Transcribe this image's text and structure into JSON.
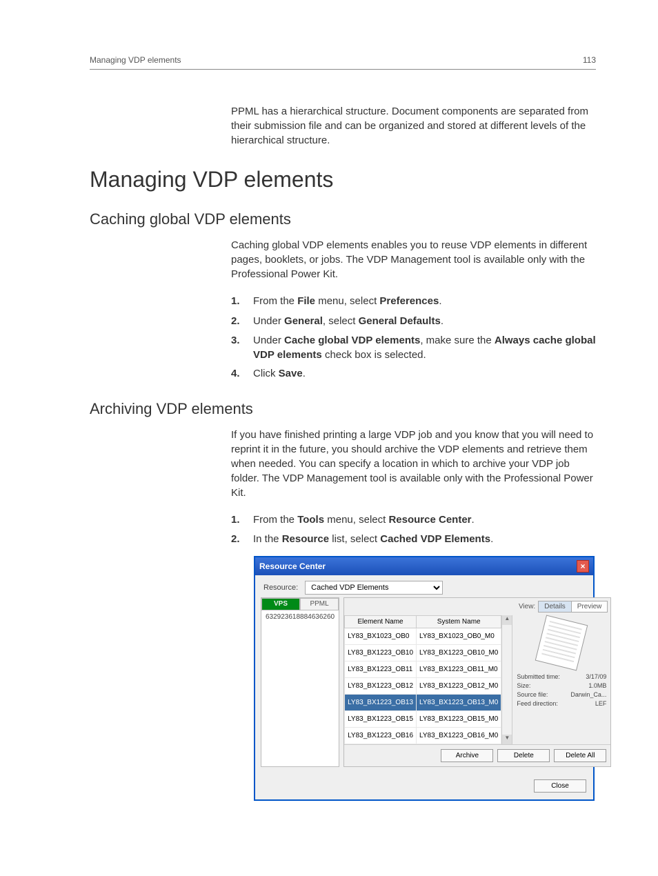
{
  "header": {
    "title": "Managing VDP elements",
    "page_num": "113"
  },
  "intro": "PPML has a hierarchical structure. Document components are separated from their submission file and can be organized and stored at different levels of the hierarchical structure.",
  "h1": "Managing VDP elements",
  "section1": {
    "heading": "Caching global VDP elements",
    "para": "Caching global VDP elements enables you to reuse VDP elements in different pages, booklets, or jobs. The VDP Management tool is available only with the Professional Power Kit.",
    "steps": {
      "s1": {
        "num": "1.",
        "prefix": "From the ",
        "b1": "File",
        "mid": " menu, select ",
        "b2": "Preferences",
        "suffix": "."
      },
      "s2": {
        "num": "2.",
        "prefix": "Under ",
        "b1": "General",
        "mid": ", select ",
        "b2": "General Defaults",
        "suffix": "."
      },
      "s3": {
        "num": "3.",
        "prefix": "Under ",
        "b1": "Cache global VDP elements",
        "mid": ", make sure the ",
        "b2": "Always cache global VDP elements",
        "suffix": " check box is selected."
      },
      "s4": {
        "num": "4.",
        "prefix": "Click ",
        "b1": "Save",
        "suffix": "."
      }
    }
  },
  "section2": {
    "heading": "Archiving VDP elements",
    "para": "If you have finished printing a large VDP job and you know that you will need to reprint it in the future, you should archive the VDP elements and retrieve them when needed. You can specify a location in which to archive your VDP job folder. The VDP Management tool is available only with the Professional Power Kit.",
    "steps": {
      "s1": {
        "num": "1.",
        "prefix": "From the ",
        "b1": "Tools",
        "mid": " menu, select ",
        "b2": "Resource Center",
        "suffix": "."
      },
      "s2": {
        "num": "2.",
        "prefix": "In the ",
        "b1": "Resource",
        "mid": " list, select ",
        "b2": "Cached VDP Elements",
        "suffix": "."
      }
    }
  },
  "dialog": {
    "title": "Resource Center",
    "resource_label": "Resource:",
    "resource_value": "Cached VDP Elements",
    "tabs": {
      "vps": "VPS",
      "ppml": "PPML"
    },
    "tree_item": "632923618884636260",
    "view_label": "View:",
    "view_toggle": {
      "details": "Details",
      "preview": "Preview"
    },
    "table": {
      "headers": {
        "element": "Element Name",
        "system": "System Name"
      },
      "rows": [
        {
          "element": "LY83_BX1023_OB0",
          "system": "LY83_BX1023_OB0_M0"
        },
        {
          "element": "LY83_BX1223_OB10",
          "system": "LY83_BX1223_OB10_M0"
        },
        {
          "element": "LY83_BX1223_OB11",
          "system": "LY83_BX1223_OB11_M0"
        },
        {
          "element": "LY83_BX1223_OB12",
          "system": "LY83_BX1223_OB12_M0"
        },
        {
          "element": "LY83_BX1223_OB13",
          "system": "LY83_BX1223_OB13_M0"
        },
        {
          "element": "LY83_BX1223_OB15",
          "system": "LY83_BX1223_OB15_M0"
        },
        {
          "element": "LY83_BX1223_OB16",
          "system": "LY83_BX1223_OB16_M0"
        }
      ]
    },
    "info": {
      "submitted_label": "Submitted time:",
      "submitted_value": "3/17/09",
      "size_label": "Size:",
      "size_value": "1.0MB",
      "source_label": "Source file:",
      "source_value": "Darwin_Ca...",
      "feed_label": "Feed direction:",
      "feed_value": "LEF"
    },
    "buttons": {
      "archive": "Archive",
      "delete": "Delete",
      "delete_all": "Delete All",
      "close": "Close"
    }
  }
}
